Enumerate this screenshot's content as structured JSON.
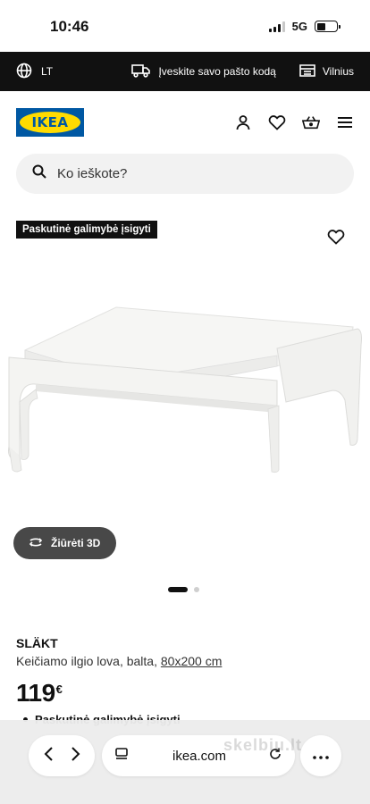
{
  "status": {
    "time": "10:46",
    "network": "5G",
    "battery_level": 0.45
  },
  "topbar": {
    "language": "LT",
    "postcode_prompt": "Įveskite savo pašto kodą",
    "store": "Vilnius"
  },
  "header": {
    "logo_text": "IKEA",
    "icons": [
      "user-icon",
      "heart-icon",
      "basket-icon",
      "menu-icon"
    ]
  },
  "search": {
    "placeholder": "Ko ieškote?"
  },
  "product": {
    "badge": "Paskutinė galimybė įsigyti",
    "view_3d_label": "Žiūrėti 3D",
    "gallery": {
      "count": 2,
      "active": 1
    },
    "name": "SLÄKT",
    "description": "Keičiamo ilgio lova, balta,",
    "size": "80x200 cm",
    "price": "119",
    "currency": "€",
    "availability": "Paskutinė galimybė įsigyti"
  },
  "browser": {
    "url": "ikea.com"
  },
  "watermark": "skelbiu.lt",
  "colors": {
    "ikea_blue": "#0058a3",
    "ikea_yellow": "#ffdb00",
    "strip_black": "#111111",
    "pill_grey": "#484848"
  }
}
